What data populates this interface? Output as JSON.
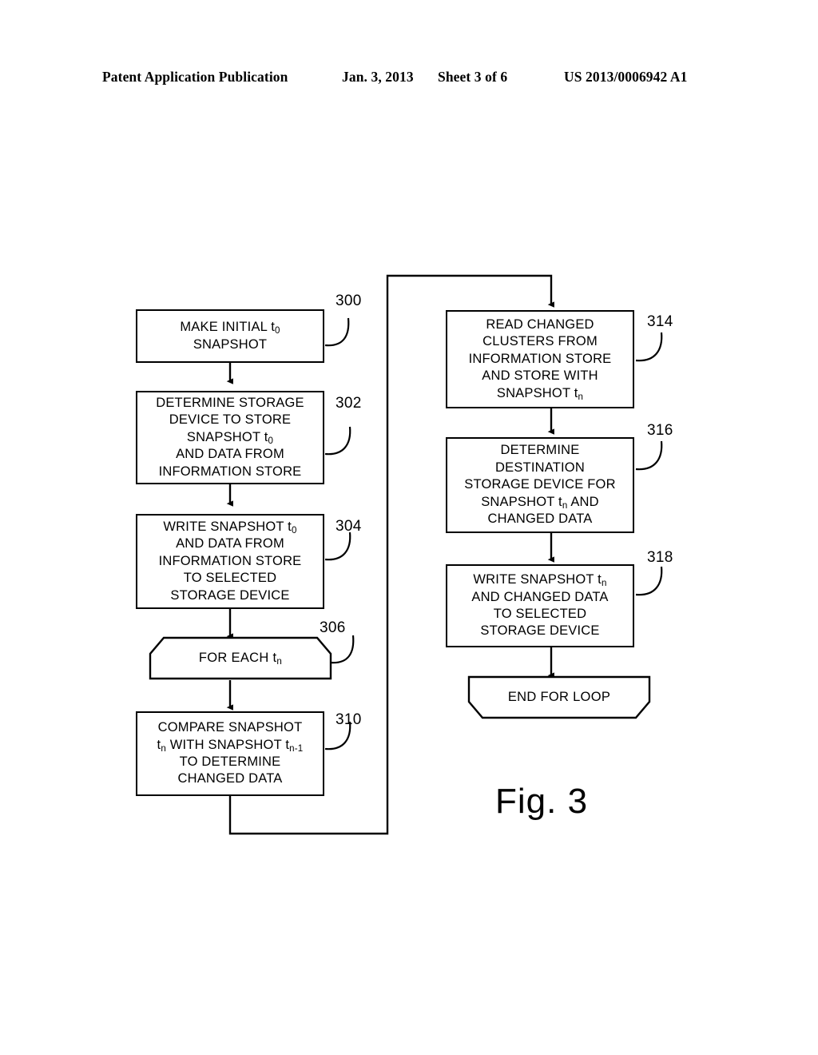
{
  "header": {
    "publication": "Patent Application Publication",
    "date": "Jan. 3, 2013",
    "sheet": "Sheet 3 of 6",
    "number": "US 2013/0006942 A1"
  },
  "figure": {
    "caption": "Fig. 3",
    "nodes": [
      {
        "id": "300",
        "ref": "300",
        "shape": "process",
        "column": "left",
        "lines": [
          "MAKE INITIAL t₀",
          "SNAPSHOT"
        ],
        "plain": "MAKE INITIAL t0 SNAPSHOT"
      },
      {
        "id": "302",
        "ref": "302",
        "shape": "process",
        "column": "left",
        "lines": [
          "DETERMINE STORAGE",
          "DEVICE TO STORE",
          "SNAPSHOT t₀",
          "AND DATA FROM",
          "INFORMATION STORE"
        ],
        "plain": "DETERMINE STORAGE DEVICE TO STORE SNAPSHOT t0 AND DATA FROM INFORMATION STORE"
      },
      {
        "id": "304",
        "ref": "304",
        "shape": "process",
        "column": "left",
        "lines": [
          "WRITE SNAPSHOT t₀",
          "AND DATA FROM",
          "INFORMATION STORE",
          "TO SELECTED",
          "STORAGE DEVICE"
        ],
        "plain": "WRITE SNAPSHOT t0 AND DATA FROM INFORMATION STORE TO SELECTED STORAGE DEVICE"
      },
      {
        "id": "306",
        "ref": "306",
        "shape": "loop-start",
        "column": "left",
        "lines": [
          "FOR EACH tₙ"
        ],
        "plain": "FOR EACH tn"
      },
      {
        "id": "310",
        "ref": "310",
        "shape": "process",
        "column": "left",
        "lines": [
          "COMPARE SNAPSHOT",
          "tₙ WITH SNAPSHOT tₙ₋₁",
          "TO DETERMINE",
          "CHANGED DATA"
        ],
        "plain": "COMPARE SNAPSHOT tn WITH SNAPSHOT tn-1 TO DETERMINE CHANGED DATA"
      },
      {
        "id": "314",
        "ref": "314",
        "shape": "process",
        "column": "right",
        "lines": [
          "READ CHANGED",
          "CLUSTERS FROM",
          "INFORMATION STORE",
          "AND STORE WITH",
          "SNAPSHOT tₙ"
        ],
        "plain": "READ CHANGED CLUSTERS FROM INFORMATION STORE AND STORE WITH SNAPSHOT tn"
      },
      {
        "id": "316",
        "ref": "316",
        "shape": "process",
        "column": "right",
        "lines": [
          "DETERMINE",
          "DESTINATION",
          "STORAGE DEVICE FOR",
          "SNAPSHOT tₙ AND",
          "CHANGED DATA"
        ],
        "plain": "DETERMINE DESTINATION STORAGE DEVICE FOR SNAPSHOT tn AND CHANGED DATA"
      },
      {
        "id": "318",
        "ref": "318",
        "shape": "process",
        "column": "right",
        "lines": [
          "WRITE SNAPSHOT tₙ",
          "AND CHANGED DATA",
          "TO SELECTED",
          "STORAGE DEVICE"
        ],
        "plain": "WRITE SNAPSHOT tn AND CHANGED DATA TO SELECTED STORAGE DEVICE"
      },
      {
        "id": "endloop",
        "ref": "",
        "shape": "loop-end",
        "column": "right",
        "lines": [
          "END FOR LOOP"
        ],
        "plain": "END FOR LOOP"
      }
    ]
  }
}
